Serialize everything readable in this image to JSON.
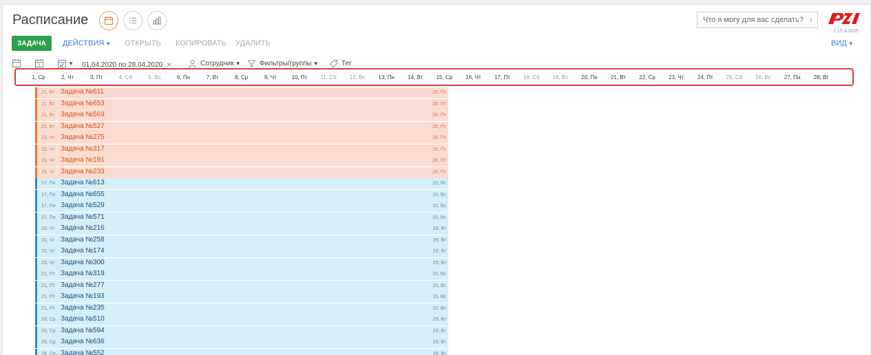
{
  "header": {
    "title": "Расписание",
    "search_placeholder": "Что я могу для вас сделать?",
    "version": "7.15.4.3055"
  },
  "toolbar": {
    "task_label": "ЗАДАЧА",
    "actions_label": "ДЕЙСТВИЯ",
    "open_label": "ОТКРЫТЬ",
    "copy_label": "КОПИРОВАТЬ",
    "delete_label": "УДАЛИТЬ",
    "view_label": "ВИД"
  },
  "filters": {
    "date_from": "01.04.2020",
    "date_to_label": "по",
    "date_to": "28.04.2020",
    "employee_label": "Сотрудник",
    "filters_groups_label": "Фильтры/группы",
    "tag_label": "Тег"
  },
  "timeline": {
    "days": [
      {
        "label": "1, Ср",
        "weekend": false
      },
      {
        "label": "2, Чт",
        "weekend": false
      },
      {
        "label": "3, Пт",
        "weekend": false
      },
      {
        "label": "4, Сб",
        "weekend": true
      },
      {
        "label": "5, Вс",
        "weekend": true
      },
      {
        "label": "6, Пн",
        "weekend": false
      },
      {
        "label": "7, Вт",
        "weekend": false
      },
      {
        "label": "8, Ср",
        "weekend": false
      },
      {
        "label": "9, Чт",
        "weekend": false
      },
      {
        "label": "10, Пт",
        "weekend": false
      },
      {
        "label": "11, Сб",
        "weekend": true
      },
      {
        "label": "12, Вс",
        "weekend": true
      },
      {
        "label": "13, Пн",
        "weekend": false
      },
      {
        "label": "14, Вт",
        "weekend": false
      },
      {
        "label": "15, Ср",
        "weekend": false
      },
      {
        "label": "16, Чт",
        "weekend": false
      },
      {
        "label": "17, Пт",
        "weekend": false
      },
      {
        "label": "18, Сб",
        "weekend": true
      },
      {
        "label": "19, Вс",
        "weekend": true
      },
      {
        "label": "20, Пн",
        "weekend": false
      },
      {
        "label": "21, Вт",
        "weekend": false
      },
      {
        "label": "22, Ср",
        "weekend": false
      },
      {
        "label": "23, Чт",
        "weekend": false
      },
      {
        "label": "24, Пт",
        "weekend": false
      },
      {
        "label": "25, Сб",
        "weekend": true
      },
      {
        "label": "26, Вс",
        "weekend": true
      },
      {
        "label": "27, Пн",
        "weekend": false
      },
      {
        "label": "28, Вт",
        "weekend": false
      }
    ]
  },
  "tasks": [
    {
      "start": "21, Вт",
      "name": "Задача №611",
      "end": "28, Пт",
      "color": "orange"
    },
    {
      "start": "21, Вт",
      "name": "Задача №653",
      "end": "28, Пт",
      "color": "orange"
    },
    {
      "start": "21, Вт",
      "name": "Задача №569",
      "end": "28, Пт",
      "color": "orange"
    },
    {
      "start": "21, Вт",
      "name": "Задача №527",
      "end": "28, Пт",
      "color": "orange"
    },
    {
      "start": "23, Чт",
      "name": "Задача №275",
      "end": "28, Пт",
      "color": "orange"
    },
    {
      "start": "23, Чт",
      "name": "Задача №317",
      "end": "28, Пт",
      "color": "orange"
    },
    {
      "start": "23, Чт",
      "name": "Задача №191",
      "end": "28, Пт",
      "color": "orange"
    },
    {
      "start": "23, Чт",
      "name": "Задача №233",
      "end": "28, Пт",
      "color": "orange"
    },
    {
      "start": "17, Пн",
      "name": "Задача №613",
      "end": "15, Вс",
      "color": "blue"
    },
    {
      "start": "17, Пн",
      "name": "Задача №655",
      "end": "15, Вс",
      "color": "blue"
    },
    {
      "start": "17, Пн",
      "name": "Задача №529",
      "end": "15, Вс",
      "color": "blue"
    },
    {
      "start": "17, Пн",
      "name": "Задача №571",
      "end": "15, Вс",
      "color": "blue"
    },
    {
      "start": "20, Чт",
      "name": "Задача №216",
      "end": "29, Вт",
      "color": "blue"
    },
    {
      "start": "20, Чт",
      "name": "Задача №258",
      "end": "29, Вт",
      "color": "blue"
    },
    {
      "start": "20, Чт",
      "name": "Задача №174",
      "end": "29, Вт",
      "color": "blue"
    },
    {
      "start": "20, Чт",
      "name": "Задача №300",
      "end": "29, Вт",
      "color": "blue"
    },
    {
      "start": "21, Пт",
      "name": "Задача №319",
      "end": "15, Вс",
      "color": "blue"
    },
    {
      "start": "21, Пт",
      "name": "Задача №277",
      "end": "15, Вс",
      "color": "blue"
    },
    {
      "start": "21, Пт",
      "name": "Задача №193",
      "end": "15, Вс",
      "color": "blue"
    },
    {
      "start": "21, Пт",
      "name": "Задача №235",
      "end": "15, Вс",
      "color": "blue"
    },
    {
      "start": "26, Ср",
      "name": "Задача №510",
      "end": "29, Вт",
      "color": "blue"
    },
    {
      "start": "26, Ср",
      "name": "Задача №594",
      "end": "29, Вт",
      "color": "blue"
    },
    {
      "start": "26, Ср",
      "name": "Задача №636",
      "end": "29, Вт",
      "color": "blue"
    },
    {
      "start": "26, Ср",
      "name": "Задача №552",
      "end": "29, Вт",
      "color": "blue"
    }
  ],
  "colors": {
    "accent": "#2ea04c",
    "link": "#3d7ec9",
    "orange_bar": "#fbdcd0",
    "blue_bar": "#d6eef9",
    "highlight": "#d43a3a",
    "logo": "#e21a1a"
  },
  "icons": [
    "calendar-icon",
    "list-icon",
    "chart-icon",
    "chevron-right-icon",
    "rzd-logo",
    "calendar-day-icon",
    "calendar-week-icon",
    "calendar-check-icon",
    "person-icon",
    "filter-icon",
    "tag-icon",
    "close-icon"
  ]
}
